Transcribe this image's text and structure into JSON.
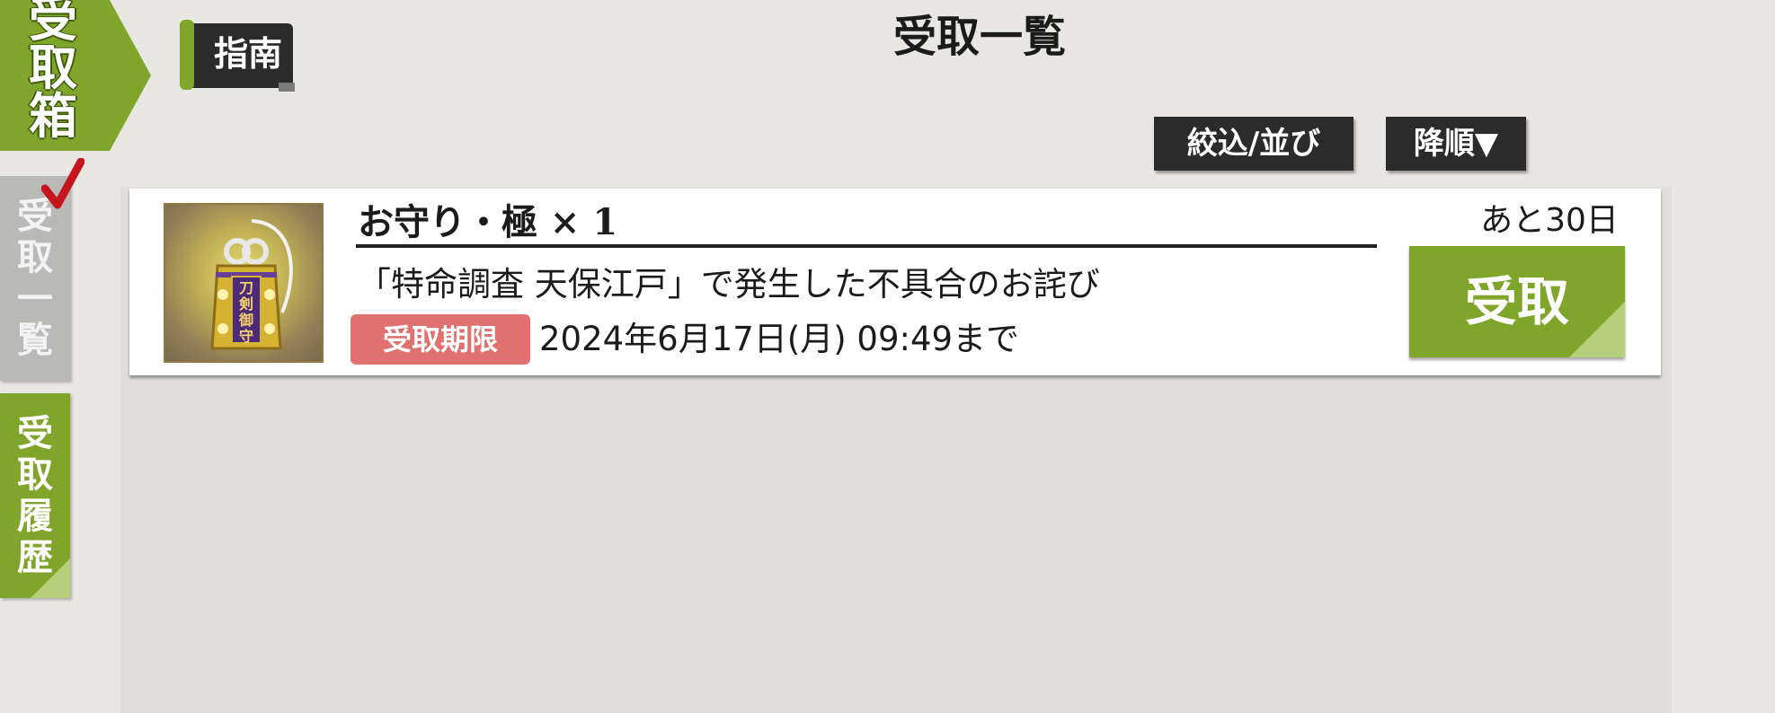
{
  "badge": {
    "lines": [
      "受",
      "取",
      "箱"
    ]
  },
  "guide": {
    "label": "指南"
  },
  "page_title": "受取一覧",
  "side_tabs": [
    {
      "label_lines": [
        "受",
        "取",
        "一",
        "覧"
      ],
      "selected": true
    },
    {
      "label_lines": [
        "受",
        "取",
        "履",
        "歴"
      ],
      "selected": false
    }
  ],
  "toolbar": {
    "filter_label": "絞込/並び",
    "order_label": "降順▼"
  },
  "items": [
    {
      "name": "お守り・極 × 1",
      "description": "「特命調査 天保江戸」で発生した不具合のお詫び",
      "deadline_label": "受取期限",
      "deadline_text": "2024年6月17日(月) 09:49まで",
      "remaining": "あと30日",
      "receive_label": "受取",
      "icon": "omamori-icon",
      "icon_text": [
        "刀",
        "剣",
        "御",
        "守"
      ]
    }
  ],
  "colors": {
    "accent_green": "#7fa52a",
    "dark_button": "#2b2b2b",
    "deadline_red": "#e07170",
    "background": "#e9e7e3"
  }
}
